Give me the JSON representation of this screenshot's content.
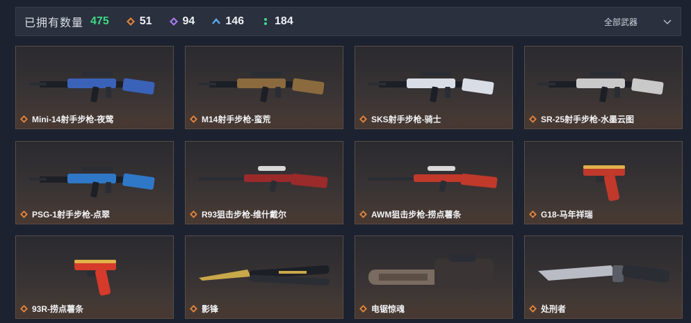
{
  "header": {
    "owned_label": "已拥有数量",
    "owned_count": "475",
    "stats": [
      {
        "icon": "orange-diamond-icon",
        "color": "#e0823a",
        "value": "51"
      },
      {
        "icon": "purple-diamond-icon",
        "color": "#a77af0",
        "value": "94"
      },
      {
        "icon": "blue-chevron-icon",
        "color": "#5aa8f0",
        "value": "146"
      },
      {
        "icon": "green-dots-icon",
        "color": "#3ddc9a",
        "value": "184"
      }
    ],
    "filter_label": "全部武器"
  },
  "weapons": [
    {
      "name": "Mini-14射手步枪-夜莺",
      "icon": "rifle-icon",
      "accent": "#3a62b8"
    },
    {
      "name": "M14射手步枪-蛮荒",
      "icon": "rifle-icon",
      "accent": "#8b6a3e"
    },
    {
      "name": "SKS射手步枪-骑士",
      "icon": "rifle-icon",
      "accent": "#d9dde6"
    },
    {
      "name": "SR-25射手步枪-水墨云图",
      "icon": "rifle-icon",
      "accent": "#c9c9c9"
    },
    {
      "name": "PSG-1射手步枪-点翠",
      "icon": "rifle-icon",
      "accent": "#2f78c8"
    },
    {
      "name": "R93狙击步枪-维什戴尔",
      "icon": "sniper-icon",
      "accent": "#9b2a2a"
    },
    {
      "name": "AWM狙击步枪-捞点薯条",
      "icon": "sniper-icon",
      "accent": "#c0392b"
    },
    {
      "name": "G18-马年祥瑞",
      "icon": "pistol-icon",
      "accent": "#c0392b"
    },
    {
      "name": "93R-捞点薯条",
      "icon": "pistol-icon",
      "accent": "#d63a2a"
    },
    {
      "name": "影锋",
      "icon": "butterfly-knife-icon",
      "accent": "#c9a84a"
    },
    {
      "name": "电锯惊魂",
      "icon": "chainsaw-icon",
      "accent": "#7a6b60"
    },
    {
      "name": "处刑者",
      "icon": "knife-icon",
      "accent": "#b9bcc4"
    }
  ]
}
